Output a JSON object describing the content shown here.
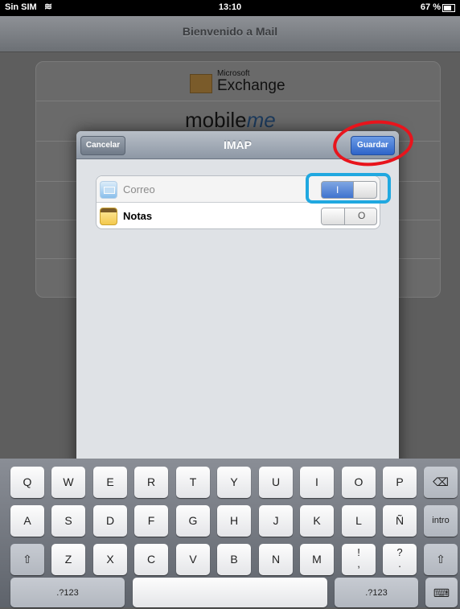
{
  "status_bar": {
    "carrier": "Sin SIM",
    "time": "13:10",
    "battery": "67 %"
  },
  "navbar": {
    "title": "Bienvenido a Mail"
  },
  "providers": {
    "exchange_small": "Microsoft",
    "exchange_name": "Exchange",
    "mobileme_a": "mobile",
    "mobileme_b": "me"
  },
  "modal": {
    "title": "IMAP",
    "cancel_label": "Cancelar",
    "save_label": "Guardar",
    "rows": [
      {
        "label": "Correo",
        "state": "I"
      },
      {
        "label": "Notas",
        "state": "O"
      }
    ]
  },
  "keyboard": {
    "row1": [
      "Q",
      "W",
      "E",
      "R",
      "T",
      "Y",
      "U",
      "I",
      "O",
      "P",
      "⌫"
    ],
    "row2": [
      "A",
      "S",
      "D",
      "F",
      "G",
      "H",
      "J",
      "K",
      "L",
      "Ñ",
      "intro"
    ],
    "row3": [
      "⇧",
      "Z",
      "X",
      "C",
      "V",
      "B",
      "N",
      "M",
      "!\n,",
      "?\n.",
      "⇧"
    ],
    "row4": [
      ".?123",
      "",
      ".?123",
      "⌨"
    ]
  },
  "colors": {
    "accent": "#2e64c9",
    "annotation_red": "#e8141c",
    "annotation_blue": "#20a8e0"
  }
}
